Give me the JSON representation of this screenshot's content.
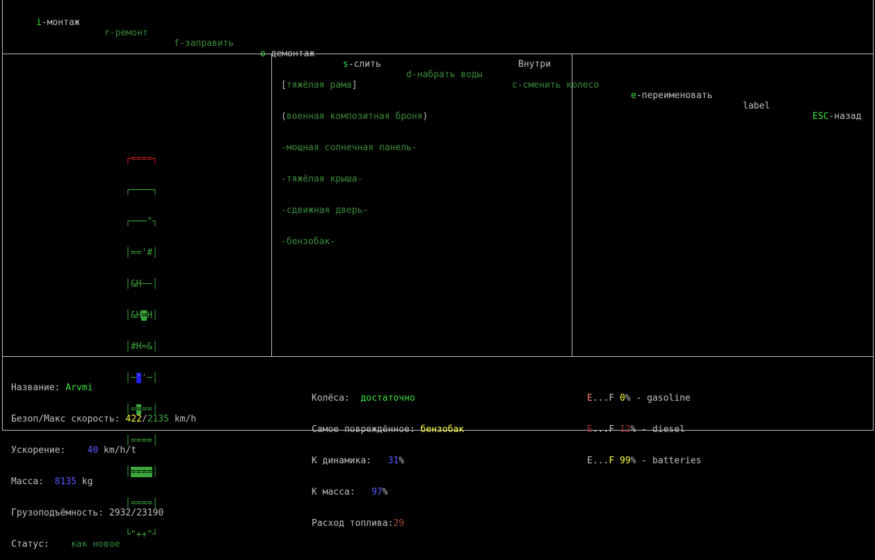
{
  "menu": [
    {
      "key": "i",
      "label": "-монтаж",
      "active": true
    },
    {
      "key": "r",
      "label": "-ремонт",
      "active": false
    },
    {
      "key": "f",
      "label": "-заправить",
      "active": false
    },
    {
      "key": "o",
      "label": "-демонтаж",
      "active": true
    },
    {
      "key": "s",
      "label": "-слить",
      "active": true
    },
    {
      "key": "d",
      "label": "-набрать воды",
      "active": false
    },
    {
      "key": "c",
      "label": "-сменить колесо",
      "active": false
    },
    {
      "key": "e",
      "label": "-переименовать",
      "active": true
    },
    {
      "key": "",
      "label": "label",
      "active": true
    },
    {
      "key": "ESC",
      "label": "-назад",
      "active": true
    }
  ],
  "parts_header": "Внутри",
  "parts": [
    {
      "prefix": "[",
      "name": "тяжёлая рама",
      "suffix": "]"
    },
    {
      "prefix": "(",
      "name": "военная композитная броня",
      "suffix": ")"
    },
    {
      "prefix": "-",
      "name": "мощная солнечная панель",
      "suffix": "-"
    },
    {
      "prefix": "-",
      "name": "тяжёлая крыша",
      "suffix": "-"
    },
    {
      "prefix": "-",
      "name": "сдвижная дверь",
      "suffix": "-"
    },
    {
      "prefix": "-",
      "name": "бензобак",
      "suffix": "-"
    }
  ],
  "vehicle_map": [
    {
      "text": "┌====┐",
      "color": "#e02020"
    },
    {
      "text": "┌────┐",
      "color": "#3aa83a"
    },
    {
      "text": "┌───\"┐",
      "color": "#3aa83a"
    },
    {
      "text": "│=='#│",
      "color": "#3aa83a"
    },
    {
      "text": "│&H──│",
      "color": "#3aa83a"
    },
    {
      "text": "│&H=H│",
      "color": "#3aa83a"
    },
    {
      "text": "│#H=&│",
      "color": "#3aa83a"
    },
    {
      "text": "│─''─│",
      "color": "#3aa83a"
    },
    {
      "text": "│====│",
      "color": "#3aa83a"
    },
    {
      "text": "│====│",
      "color": "#3aa83a"
    },
    {
      "text": "│====│",
      "color": "#3aa83a"
    },
    {
      "text": "│====│",
      "color": "#3aa83a"
    },
    {
      "text": "└\"++\"┘",
      "color": "#3aa83a"
    }
  ],
  "stats": {
    "name_label": "Название: ",
    "name_value": "Arvmi",
    "speed_label": "Безоп/Макс скорость: ",
    "speed_safe": "422",
    "speed_sep": "/",
    "speed_max": "2135",
    "speed_unit": " km/h",
    "accel_label": "Ускорение:    ",
    "accel_value": "40",
    "accel_unit": " km/h/t",
    "mass_label": "Масса:  ",
    "mass_value": "8135",
    "mass_unit": " kg",
    "cargo_label": "Грузоподъёмность: ",
    "cargo_value": "2932/23190",
    "status_label": "Статус:    ",
    "status_value": "как новое"
  },
  "stats2": {
    "wheels_label": "Колёса:  ",
    "wheels_value": "достаточно",
    "damaged_label": "Самое повреждённое: ",
    "damaged_value": "бензобак",
    "dyn_label": "К динамика:   ",
    "dyn_value": "31",
    "dyn_unit": "%",
    "kmass_label": "К масса:   ",
    "kmass_value": "97",
    "kmass_unit": "%",
    "fuel_label": "Расход топлива:",
    "fuel_value": "29"
  },
  "fuel": [
    {
      "e": "E",
      "dots": "...",
      "f": "F",
      "pct": "0",
      "rest": "% - gasoline",
      "ecolor": "#ff8080",
      "pctcolor": "#ffff40"
    },
    {
      "e": "E",
      "dots": "...",
      "f": "F",
      "pct": "12",
      "rest": "% - diesel",
      "ecolor": "#a03030",
      "pctcolor": "#a03030"
    },
    {
      "e": "E",
      "dots": "...",
      "f": "F",
      "pct": "99",
      "rest": "% - batteries",
      "ecolor": "#c0c0c0",
      "pctcolor": "#ffff40"
    }
  ],
  "colors": {
    "active_key": "#39e339",
    "inactive": "#3a8a3a",
    "blue": "#5a5aff",
    "yellow": "#ffff40",
    "brown": "#a05030"
  }
}
